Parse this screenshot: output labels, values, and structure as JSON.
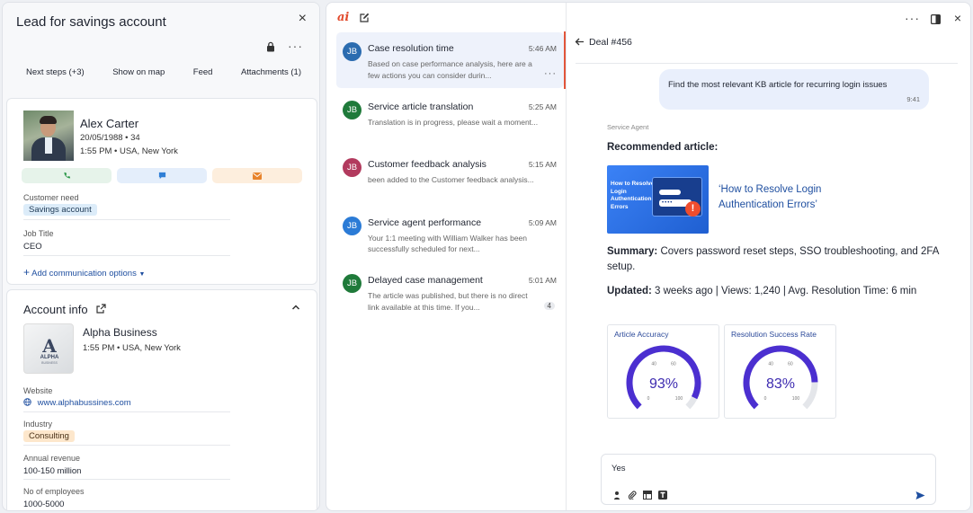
{
  "left_panel": {
    "title": "Lead for savings account",
    "close_label": "×",
    "more_label": "···",
    "tabs": [
      "Next steps (+3)",
      "Show on map",
      "Feed",
      "Attachments (1)"
    ]
  },
  "contact": {
    "name": "Alex Carter",
    "dob": "20/05/1988 • 34",
    "time": "1:55 PM • USA, New York",
    "customer_need_label": "Customer need",
    "customer_need": "Savings account",
    "job_title_label": "Job Title",
    "job_title": "CEO",
    "add_comm": "Add communication options"
  },
  "account": {
    "title": "Account info",
    "name": "Alpha Business",
    "time": "1:55 PM • USA, New York",
    "logo_letter": "A",
    "logo_text": "ALPHA",
    "logo_sub": "BUSINESS",
    "website_label": "Website",
    "website": "www.alphabussines.com",
    "industry_label": "Industry",
    "industry": "Consulting",
    "revenue_label": "Annual revenue",
    "revenue": "100-150 million",
    "employees_label": "No of employees",
    "employees": "1000-5000"
  },
  "mid": {
    "logo": "ai",
    "conversations": [
      {
        "initials": "JB",
        "title": "Case resolution time",
        "time": "5:46 AM",
        "preview": "Based on case performance analysis, here are a few actions you can consider durin...",
        "color": "#2b6cb0"
      },
      {
        "initials": "JB",
        "title": "Service article translation",
        "time": "5:25 AM",
        "preview": "Translation is in progress, please wait a moment...",
        "color": "#1f7a3a"
      },
      {
        "initials": "JB",
        "title": "Customer feedback analysis",
        "time": "5:15 AM",
        "preview": "been added to the Customer feedback analysis...",
        "color": "#b23a5e"
      },
      {
        "initials": "JB",
        "title": "Service agent performance",
        "time": "5:09 AM",
        "preview": "Your 1:1 meeting with William Walker has been successfully scheduled for next...",
        "color": "#2b7bd6"
      },
      {
        "initials": "JB",
        "title": "Delayed case management",
        "time": "5:01 AM",
        "preview": "The article was published, but there is no direct link available at this time. If you...",
        "color": "#1f7a3a",
        "badge": "4"
      }
    ]
  },
  "chat": {
    "title": "Deal #456",
    "more_label": "···",
    "close_label": "×",
    "user_message": "Find the most relevant KB article for recurring login issues",
    "user_time": "9:41",
    "agent_label": "Service Agent",
    "recommended": "Recommended article:",
    "thumb_title": "How to Resolve Login Authentication Errors",
    "thumb_field_dots": "••••",
    "thumb_warn": "!",
    "article_link": "‘How to Resolve Login Authentication Errors’",
    "summary_label": "Summary:",
    "summary": " Covers password reset steps, SSO troubleshooting, and 2FA setup.",
    "updated_label": "Updated:",
    "updated": " 3 weeks ago | Views: 1,240 | Avg. Resolution Time: 6 min",
    "gauges": [
      {
        "title": "Article Accuracy",
        "value": 93,
        "display": "93%",
        "ticks": [
          "0",
          "40",
          "60",
          "100"
        ]
      },
      {
        "title": "Resolution Success Rate",
        "value": 83,
        "display": "83%",
        "ticks": [
          "0",
          "40",
          "60",
          "100"
        ]
      }
    ],
    "composer_value": "Yes"
  },
  "colors": {
    "accent": "#1f4fa0",
    "active_marker": "#e2553a",
    "gauge": "#4b2fd0"
  }
}
